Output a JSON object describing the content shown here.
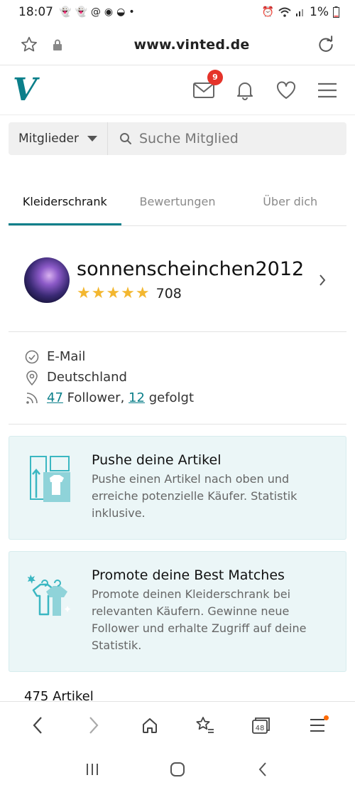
{
  "statusbar": {
    "time": "18:07",
    "battery": "1%"
  },
  "browser": {
    "url": "www.vinted.de",
    "tabs_count": "48"
  },
  "header": {
    "logo": "V",
    "messages_badge": "9"
  },
  "search": {
    "filter": "Mitglieder",
    "placeholder": "Suche Mitglied"
  },
  "tabs": [
    {
      "label": "Kleiderschrank"
    },
    {
      "label": "Bewertungen"
    },
    {
      "label": "Über dich"
    }
  ],
  "profile": {
    "username": "sonnenscheinchen2012",
    "stars": "★★★★★",
    "rating_count": "708"
  },
  "details": {
    "email": "E-Mail",
    "country": "Deutschland",
    "followers_count": "47",
    "followers_label": "Follower,",
    "following_count": "12",
    "following_label": "gefolgt"
  },
  "cards": [
    {
      "title": "Pushe deine Artikel",
      "body": "Pushe einen Artikel nach oben und erreiche potenzielle Käufer. Statistik inklusive."
    },
    {
      "title": "Promote deine Best Matches",
      "body": "Promote deinen Kleiderschrank bei relevanten Käufern. Gewinne neue Follower und erhalte Zugriff auf deine Statistik."
    }
  ],
  "articles": "475 Artikel",
  "colors": {
    "accent": "#0b7f8a",
    "star": "#f3b730",
    "badge": "#e5332a",
    "card_bg": "#ebf6f7"
  }
}
